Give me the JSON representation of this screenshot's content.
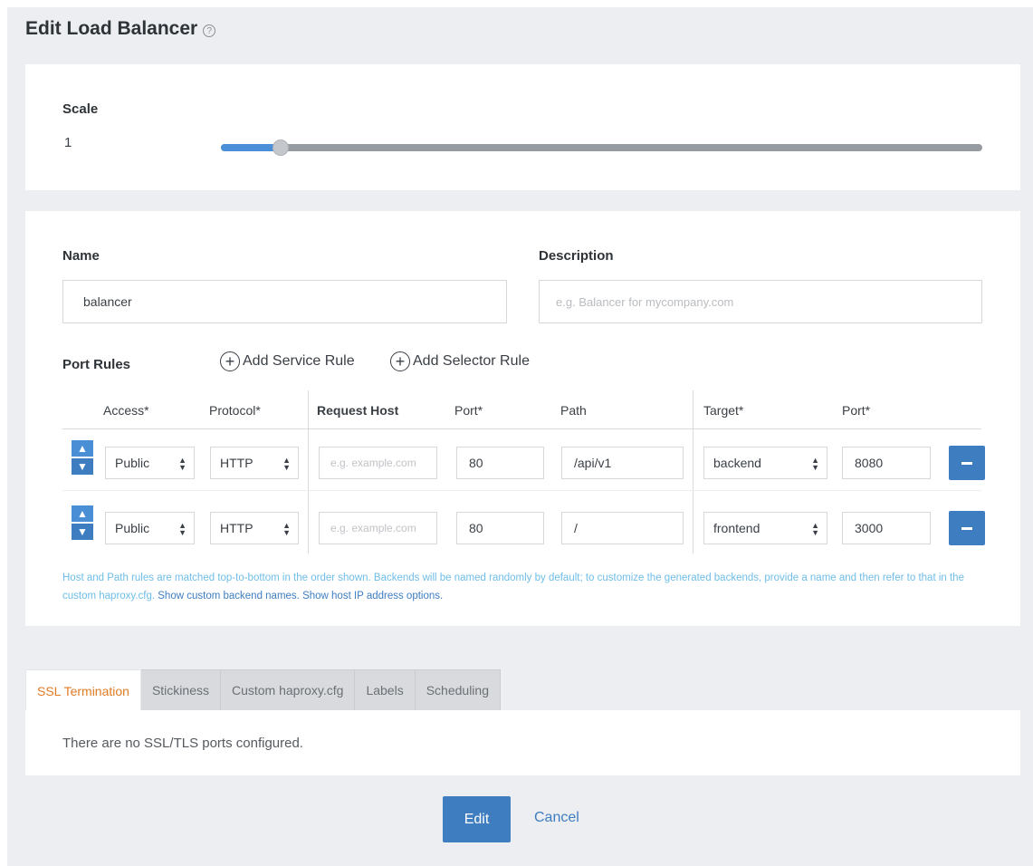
{
  "page": {
    "title": "Edit Load Balancer",
    "help_icon": "?"
  },
  "scale": {
    "label": "Scale",
    "value": "1",
    "slider_level_fraction": 0.07
  },
  "form": {
    "name_label": "Name",
    "name_value": "balancer",
    "description_label": "Description",
    "description_placeholder": "e.g. Balancer for mycompany.com"
  },
  "port_rules": {
    "label": "Port Rules",
    "add_service_rule": "Add Service Rule",
    "add_selector_rule": "Add Selector Rule",
    "columns": {
      "access": "Access*",
      "protocol": "Protocol*",
      "request_host": "Request Host",
      "port": "Port*",
      "path": "Path",
      "target": "Target*",
      "target_port": "Port*"
    },
    "host_placeholder": "e.g. example.com",
    "rows": [
      {
        "access": "Public",
        "protocol": "HTTP",
        "port": "80",
        "path": "/api/v1",
        "target": "backend",
        "target_port": "8080"
      },
      {
        "access": "Public",
        "protocol": "HTTP",
        "port": "80",
        "path": "/",
        "target": "frontend",
        "target_port": "3000"
      }
    ],
    "help_text": "Host and Path rules are matched top-to-bottom in the order shown. Backends will be named randomly by default; to customize the generated backends, provide a name and then refer to that in the custom haproxy.cfg.",
    "show_backend_names": "Show custom backend names.",
    "show_host_ip": "Show host IP address options."
  },
  "tabs": [
    {
      "label": "SSL Termination",
      "active": true
    },
    {
      "label": "Stickiness",
      "active": false
    },
    {
      "label": "Custom haproxy.cfg",
      "active": false
    },
    {
      "label": "Labels",
      "active": false
    },
    {
      "label": "Scheduling",
      "active": false
    }
  ],
  "ssl": {
    "empty_text": "There are no SSL/TLS ports configured."
  },
  "actions": {
    "edit": "Edit",
    "cancel": "Cancel"
  },
  "icons": {
    "up": "chevron-up-icon",
    "down": "chevron-down-icon",
    "plus": "plus-circle-icon",
    "minus": "minus-icon",
    "help": "help-icon"
  },
  "colors": {
    "accent": "#3e7dc0",
    "active_tab": "#e07b24",
    "help_text": "#6fbde6"
  }
}
